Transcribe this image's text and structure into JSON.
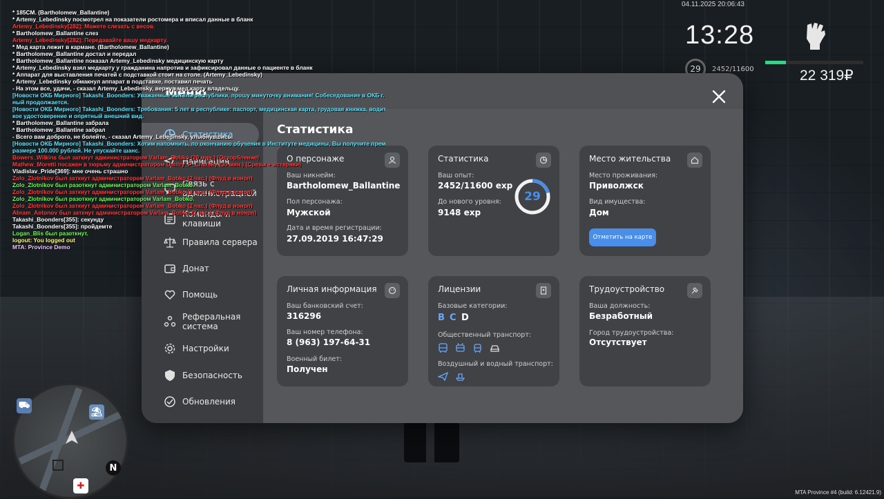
{
  "chat": [
    {
      "text": " * 185СМ. (Bartholomew_Ballantine)",
      "color": "c-white"
    },
    {
      "text": " * Artemy_Lebedinsky посмотрел на показатели ростомера и вписал данные в бланк",
      "color": "c-white"
    },
    {
      "text": "Artemy_Lebedinsky[282]: Можете слезать с весов.",
      "color": "c-red"
    },
    {
      "text": " * Bartholomew_Ballantine слез",
      "color": "c-white"
    },
    {
      "text": "Artemy_Lebedinsky[282]: Передавайте вашу медкарту.",
      "color": "c-red"
    },
    {
      "text": " * Мед карта лежит в кармане. (Bartholomew_Ballantine)",
      "color": "c-white"
    },
    {
      "text": " * Bartholomew_Ballantine достал и передал",
      "color": "c-white"
    },
    {
      "text": " * Bartholomew_Ballantine показал Artemy_Lebedinsky медицинскую карту",
      "color": "c-white"
    },
    {
      "text": " * Artemy_Lebedinsky взял медкарту у гражданина напротив и зафиксировал данные о пациенте в бланк",
      "color": "c-white"
    },
    {
      "text": " * Аппарат для выставления печатей с подставкой стоит на столе. (Artemy_Lebedinsky)",
      "color": "c-white"
    },
    {
      "text": " * Artemy_Lebedinsky обмакнул аппарат в подставке, поставил печать",
      "color": "c-white"
    },
    {
      "text": " - На этом все, удачи, - сказал Artemy_Lebedinsky, вернув мед.карту владельцу.",
      "color": "c-white"
    },
    {
      "text": "[Новости ОКБ Мирного] Takashi_Boonders: Уважаемые жители республики, прошу минуточку внимания! Собеседование в ОКБ г. Мир",
      "color": "c-cyan"
    },
    {
      "text": "ный продолжается.",
      "color": "c-cyan"
    },
    {
      "text": "[Новости ОКБ Мирного] Takashi_Boonders: Требования: 5 лет в республике: паспорт, медицинская карта, трудовая книжка, водительс",
      "color": "c-cyan"
    },
    {
      "text": "кое удостоверение и опрятный внешний вид.",
      "color": "c-cyan"
    },
    {
      "text": " * Bartholomew_Ballantine забрала",
      "color": "c-white"
    },
    {
      "text": " * Bartholomew_Ballantine забрал",
      "color": "c-white"
    },
    {
      "text": " - Всего вам доброго, не болейте, - сказал Artemy_Lebedinsky, улыбнувшись.",
      "color": "c-white"
    },
    {
      "text": "[Новости ОКБ Мирного] Takashi_Boonders: Хотим напомнить, по окончанию обучения в Институте медицины, Вы получите премию в",
      "color": "c-cyan"
    },
    {
      "text": "размере 100.000 рублей. Не упускайте шанс.",
      "color": "c-cyan"
    },
    {
      "text": "Bowers_Wilkins был заткнут администратором Varlam_Bobko (20 мин.) (Оскорбление)",
      "color": "c-red"
    },
    {
      "text": "Mathew_Moretti посажен в тюрьму администратором Dmitry_P_Chatsky (30 мин.) (Срезы + истерики)",
      "color": "c-red"
    },
    {
      "text": "Vladislav_Pride[369]: мне очень страшно",
      "color": "c-white"
    },
    {
      "text": "Zolo_Zlotnikov был заткнут администратором Varlam_Bobko (2 час.) (Флуд в нонрп)",
      "color": "c-red"
    },
    {
      "text": "Zolo_Zlotnikov был разоткнут администратором Varlam_Bobko.",
      "color": "c-green"
    },
    {
      "text": "Zolo_Zlotnikov был заткнут администратором Varlam_Bobko (2 час.) (Флуд в нонрп)",
      "color": "c-red"
    },
    {
      "text": "Zolo_Zlotnikov был разоткнут администратором Varlam_Bobko.",
      "color": "c-green"
    },
    {
      "text": "Zolo_Zlotnikov был заткнут администратором Varlam_Bobko (2 час.) (Флуд в нонрп)",
      "color": "c-red"
    },
    {
      "text": "Abram_Antonov был заткнут администратором Varlam_Bobko (2 час.) (Флуд в нонрп)",
      "color": "c-red"
    },
    {
      "text": "Takashi_Boonders[355]: секунду",
      "color": "c-white"
    },
    {
      "text": "Takashi_Boonders[355]: пройдемте",
      "color": "c-white"
    },
    {
      "text": "Logan_Blis был разоткнут.",
      "color": "c-green"
    },
    {
      "text": "logout: You logged out",
      "color": "c-yellow"
    },
    {
      "text": "MTA: Province Demo",
      "color": "c-pink"
    }
  ],
  "hud": {
    "date": "04.11.2025 20:06:43",
    "time": "13:28",
    "level": "29",
    "exp": "2452/11600",
    "exp_fraction": 0.211,
    "money": "22 319₽",
    "bar_color": "#3ed08a"
  },
  "menu": {
    "title": "Меню",
    "nav": [
      {
        "label": "Статистика",
        "icon": "chart-icon",
        "active": true
      },
      {
        "label": "Навигация",
        "icon": "navigation-icon",
        "active": false
      },
      {
        "label": "Связь с администрацией",
        "icon": "chat-icon",
        "active": false
      },
      {
        "label": "Команды и клавиши",
        "icon": "keyboard-icon",
        "active": false
      },
      {
        "label": "Правила сервера",
        "icon": "scales-icon",
        "active": false
      },
      {
        "label": "Донат",
        "icon": "wallet-icon",
        "active": false
      },
      {
        "label": "Помощь",
        "icon": "heart-hand-icon",
        "active": false
      },
      {
        "label": "Реферальная система",
        "icon": "referral-icon",
        "active": false
      },
      {
        "label": "Настройки",
        "icon": "gear-icon",
        "active": false
      },
      {
        "label": "Безопасность",
        "icon": "shield-icon",
        "active": false
      },
      {
        "label": "Обновления",
        "icon": "update-icon",
        "active": false
      }
    ]
  },
  "stats": {
    "heading": "Статистика",
    "character": {
      "title": "О персонаже",
      "nickname_label": "Ваш никнейм:",
      "nickname": "Bartholomew_Ballantine",
      "gender_label": "Пол персонажа:",
      "gender": "Мужской",
      "reg_label": "Дата и время регистрации:",
      "reg": "27.09.2019 16:47:29"
    },
    "statistics": {
      "title": "Статистика",
      "exp_label": "Ваш опыт:",
      "exp": "2452/11600 exp",
      "next_label": "До нового уровня:",
      "next": "9148 exp",
      "level": "29",
      "progress": 0.211,
      "ring_color": "#4a8ee8"
    },
    "residence": {
      "title": "Место жительства",
      "place_label": "Место проживания:",
      "place": "Приволжск",
      "property_label": "Вид имущества:",
      "property": "Дом",
      "button": "Отметить на карте"
    },
    "personal": {
      "title": "Личная информация",
      "bank_label": "Ваш банковский счет:",
      "bank": "316296",
      "phone_label": "Ваш номер телефона:",
      "phone": "8 (963) 197-64-31",
      "military_label": "Военный билет:",
      "military": "Получен"
    },
    "licenses": {
      "title": "Лицензии",
      "base_label": "Базовые категории:",
      "cat_b": "B",
      "cat_c": "C",
      "cat_d": "D",
      "public_label": "Общественный транспорт:",
      "air_label": "Воздушный и водный транспорт:",
      "active_color": "#6aa8ff"
    },
    "employment": {
      "title": "Трудоустройство",
      "position_label": "Ваша должность:",
      "position": "Безработный",
      "city_label": "Город трудоустройства:",
      "city": "Отсутствует"
    }
  },
  "footer": {
    "build": "MTA Province #4 (build: 6.12421.9)"
  }
}
